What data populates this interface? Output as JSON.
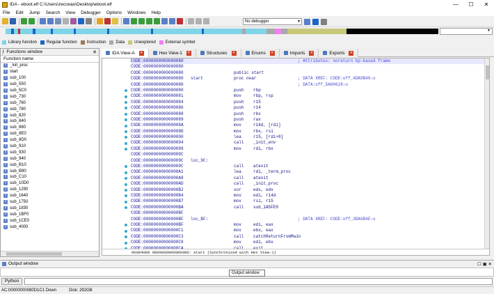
{
  "titlebar": {
    "title": "IDA - eboot.elf C:\\Users\\zecoxao\\Desktop\\eboot.elf",
    "minimize": "—",
    "maximize": "☐",
    "close": "✕"
  },
  "menu": [
    "File",
    "Edit",
    "Jump",
    "Search",
    "View",
    "Debugger",
    "Options",
    "Windows",
    "Help"
  ],
  "toolbar": {
    "debugger": "No debugger"
  },
  "legend": [
    {
      "label": "Library function",
      "color": "#7fd4e8"
    },
    {
      "label": "Regular function",
      "color": "#1a66c8"
    },
    {
      "label": "Instruction",
      "color": "#a07858"
    },
    {
      "label": "Data",
      "color": "#a8a8a8"
    },
    {
      "label": "Unexplored",
      "color": "#c8c87a"
    },
    {
      "label": "External symbol",
      "color": "#f080f0"
    }
  ],
  "functions_window": {
    "title": "Functions window",
    "column": "Function name",
    "items": [
      "_init_proc",
      "start",
      "sub_100",
      "sub_550",
      "sub_5C0",
      "sub_730",
      "sub_760",
      "sub_780",
      "sub_820",
      "sub_840",
      "sub_880",
      "sub_8E0",
      "sub_8D0",
      "sub_910",
      "sub_930",
      "sub_940",
      "sub_B10",
      "sub_B90",
      "sub_C10",
      "sub_10D0",
      "sub_1290",
      "sub_1640",
      "sub_1750",
      "sub_1830",
      "sub_1BF0",
      "sub_1CE0",
      "sub_4000"
    ]
  },
  "tabs": [
    {
      "label": "IDA View-A",
      "active": true
    },
    {
      "label": "Hex View-1",
      "active": false
    },
    {
      "label": "Structures",
      "active": false
    },
    {
      "label": "Enums",
      "active": false
    },
    {
      "label": "Imports",
      "active": false
    },
    {
      "label": "Exports",
      "active": false
    }
  ],
  "disasm": [
    {
      "addr": "CODE:0000000000000080",
      "label": "",
      "mn": "",
      "op": "",
      "cm": "; Attributes: noreturn bp-based frame",
      "dot": false,
      "hl": true
    },
    {
      "addr": "CODE:0000000000000080",
      "label": "",
      "mn": "",
      "op": "",
      "cm": "",
      "dot": false
    },
    {
      "addr": "CODE:0000000000000080",
      "label": "",
      "mn": "public start",
      "op": "",
      "cm": "",
      "dot": false
    },
    {
      "addr": "CODE:0000000000000080",
      "label": "start",
      "mn": "proc near",
      "op": "",
      "cm": "; DATA XREF: CODE:off_4DA9B40↓o",
      "dot": false
    },
    {
      "addr": "CODE:0000000000000080",
      "label": "",
      "mn": "",
      "op": "",
      "cm": "; DATA:off_5A00628↓o",
      "dot": false
    },
    {
      "addr": "CODE:0000000000000080",
      "label": "",
      "mn": "push",
      "op": "rbp",
      "cm": "",
      "dot": true
    },
    {
      "addr": "CODE:0000000000000081",
      "label": "",
      "mn": "mov",
      "op": "rbp, rsp",
      "cm": "",
      "dot": true
    },
    {
      "addr": "CODE:0000000000000084",
      "label": "",
      "mn": "push",
      "op": "r15",
      "cm": "",
      "dot": true
    },
    {
      "addr": "CODE:0000000000000086",
      "label": "",
      "mn": "push",
      "op": "r14",
      "cm": "",
      "dot": true
    },
    {
      "addr": "CODE:0000000000000088",
      "label": "",
      "mn": "push",
      "op": "rbx",
      "cm": "",
      "dot": true
    },
    {
      "addr": "CODE:0000000000000089",
      "label": "",
      "mn": "push",
      "op": "rax",
      "cm": "",
      "dot": true
    },
    {
      "addr": "CODE:000000000000008A",
      "label": "",
      "mn": "mov",
      "op": "r14d, [rdi]",
      "cm": "",
      "dot": true
    },
    {
      "addr": "CODE:000000000000008D",
      "label": "",
      "mn": "mov",
      "op": "rbx, rsi",
      "cm": "",
      "dot": true
    },
    {
      "addr": "CODE:0000000000000090",
      "label": "",
      "mn": "lea",
      "op": "r15, [rdi+8]",
      "cm": "",
      "dot": true
    },
    {
      "addr": "CODE:0000000000000094",
      "label": "",
      "mn": "call",
      "op": "_init_env",
      "cm": "",
      "dot": true
    },
    {
      "addr": "CODE:0000000000000099",
      "label": "",
      "mn": "mov",
      "op": "rdi, rbx",
      "cm": "",
      "dot": true
    },
    {
      "addr": "CODE:000000000000009C",
      "label": "",
      "mn": "",
      "op": "",
      "cm": "",
      "dot": false
    },
    {
      "addr": "CODE:000000000000009C",
      "label": "loc_9C:",
      "mn": "",
      "op": "",
      "cm": "",
      "dot": false
    },
    {
      "addr": "CODE:000000000000009C",
      "label": "",
      "mn": "call",
      "op": "atexit",
      "cm": "",
      "dot": true
    },
    {
      "addr": "CODE:00000000000000A1",
      "label": "",
      "mn": "lea",
      "op": "rdi, _term_proc",
      "cm": "",
      "dot": true
    },
    {
      "addr": "CODE:00000000000000A8",
      "label": "",
      "mn": "call",
      "op": "atexit",
      "cm": "",
      "dot": true
    },
    {
      "addr": "CODE:00000000000000AD",
      "label": "",
      "mn": "call",
      "op": "_init_proc",
      "cm": "",
      "dot": true
    },
    {
      "addr": "CODE:00000000000000B2",
      "label": "",
      "mn": "xor",
      "op": "edx, edx",
      "cm": "",
      "dot": true
    },
    {
      "addr": "CODE:00000000000000B4",
      "label": "",
      "mn": "mov",
      "op": "edi, r14d",
      "cm": "",
      "dot": true
    },
    {
      "addr": "CODE:00000000000000B7",
      "label": "",
      "mn": "mov",
      "op": "rsi, r15",
      "cm": "",
      "dot": true
    },
    {
      "addr": "CODE:00000000000000BA",
      "label": "",
      "mn": "call",
      "op": "sub_1A5FE0",
      "cm": "",
      "dot": true
    },
    {
      "addr": "CODE:00000000000000BF",
      "label": "",
      "mn": "",
      "op": "",
      "cm": "",
      "dot": false
    },
    {
      "addr": "CODE:00000000000000BF",
      "label": "loc_BF:",
      "mn": "",
      "op": "",
      "cm": "; DATA XREF: CODE:off_3DA9B4E↓o",
      "dot": false
    },
    {
      "addr": "CODE:00000000000000BF",
      "label": "",
      "mn": "mov",
      "op": "edi, eax",
      "cm": "",
      "dot": true
    },
    {
      "addr": "CODE:00000000000000C1",
      "label": "",
      "mn": "mov",
      "op": "ebx, eax",
      "cm": "",
      "dot": true
    },
    {
      "addr": "CODE:00000000000000C3",
      "label": "",
      "mn": "call",
      "op": "catchReturnFromMain",
      "cm": "",
      "dot": true
    },
    {
      "addr": "CODE:00000000000000C8",
      "label": "",
      "mn": "mov",
      "op": "edi, ebx",
      "cm": "",
      "dot": true
    },
    {
      "addr": "CODE:00000000000000CA",
      "label": "",
      "mn": "call",
      "op": "exit",
      "cm": "",
      "dot": true
    }
  ],
  "disasm_status": "00004080 0000000000000080: start (Synchronized with Hex View-1)",
  "output": {
    "title": "Output window",
    "tooltip": "Output window"
  },
  "python_button": "Python",
  "status": {
    "address": "AC:00000000080D1C1 Down",
    "disk": "Disk: 292GB"
  }
}
